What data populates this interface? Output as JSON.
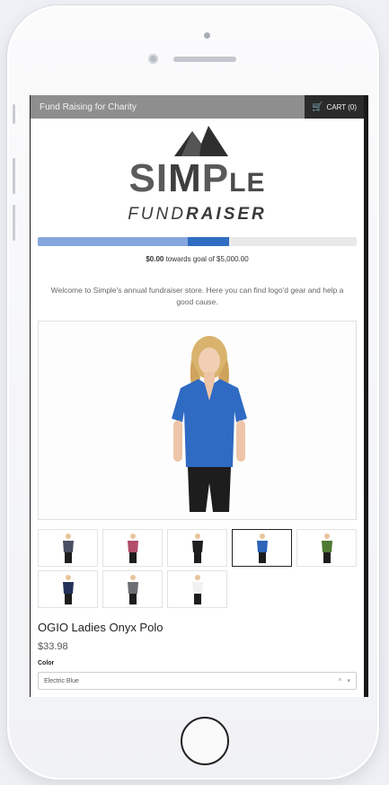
{
  "header": {
    "store_title": "Fund Raising for Charity",
    "cart_label": "CART (0)",
    "cart_icon": "cart-icon"
  },
  "logo": {
    "brand_si": "SI",
    "brand_m": "M",
    "brand_p": "P",
    "brand_le": "LE",
    "sub_fund": "FUND",
    "sub_raiser": "RAISER",
    "mark_icon": "mountain-icon"
  },
  "progress": {
    "raised_amount": "$0.00",
    "towards_text": " towards goal of $5,000.00",
    "fill_fraction": 0.6
  },
  "welcome_text": "Welcome to Simple's annual fundraiser store. Here you can find logo'd gear and help a good cause.",
  "product": {
    "title": "OGIO Ladies Onyx Polo",
    "price": "$33.98",
    "color_label": "Color",
    "color_selected": "Electric Blue",
    "clear_icon": "×",
    "dropdown_icon": "▾",
    "thumbnail_colors": [
      "#4a5063",
      "#b24d6a",
      "#1f1f1f",
      "#2d63b8",
      "#4e7a33",
      "#223259",
      "#6c6e73",
      "#f1f1f1"
    ],
    "selected_index": 3,
    "main_color": "#2f6ac3"
  }
}
